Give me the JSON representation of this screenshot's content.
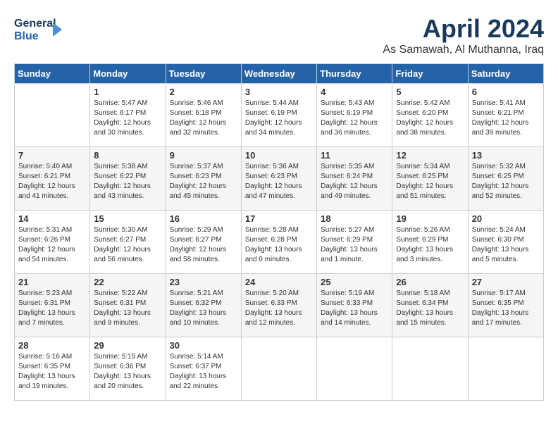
{
  "header": {
    "logo_line1": "General",
    "logo_line2": "Blue",
    "month": "April 2024",
    "location": "As Samawah, Al Muthanna, Iraq"
  },
  "days_of_week": [
    "Sunday",
    "Monday",
    "Tuesday",
    "Wednesday",
    "Thursday",
    "Friday",
    "Saturday"
  ],
  "weeks": [
    [
      {
        "day": "",
        "content": ""
      },
      {
        "day": "1",
        "content": "Sunrise: 5:47 AM\nSunset: 6:17 PM\nDaylight: 12 hours\nand 30 minutes."
      },
      {
        "day": "2",
        "content": "Sunrise: 5:46 AM\nSunset: 6:18 PM\nDaylight: 12 hours\nand 32 minutes."
      },
      {
        "day": "3",
        "content": "Sunrise: 5:44 AM\nSunset: 6:19 PM\nDaylight: 12 hours\nand 34 minutes."
      },
      {
        "day": "4",
        "content": "Sunrise: 5:43 AM\nSunset: 6:19 PM\nDaylight: 12 hours\nand 36 minutes."
      },
      {
        "day": "5",
        "content": "Sunrise: 5:42 AM\nSunset: 6:20 PM\nDaylight: 12 hours\nand 38 minutes."
      },
      {
        "day": "6",
        "content": "Sunrise: 5:41 AM\nSunset: 6:21 PM\nDaylight: 12 hours\nand 39 minutes."
      }
    ],
    [
      {
        "day": "7",
        "content": "Sunrise: 5:40 AM\nSunset: 6:21 PM\nDaylight: 12 hours\nand 41 minutes."
      },
      {
        "day": "8",
        "content": "Sunrise: 5:38 AM\nSunset: 6:22 PM\nDaylight: 12 hours\nand 43 minutes."
      },
      {
        "day": "9",
        "content": "Sunrise: 5:37 AM\nSunset: 6:23 PM\nDaylight: 12 hours\nand 45 minutes."
      },
      {
        "day": "10",
        "content": "Sunrise: 5:36 AM\nSunset: 6:23 PM\nDaylight: 12 hours\nand 47 minutes."
      },
      {
        "day": "11",
        "content": "Sunrise: 5:35 AM\nSunset: 6:24 PM\nDaylight: 12 hours\nand 49 minutes."
      },
      {
        "day": "12",
        "content": "Sunrise: 5:34 AM\nSunset: 6:25 PM\nDaylight: 12 hours\nand 51 minutes."
      },
      {
        "day": "13",
        "content": "Sunrise: 5:32 AM\nSunset: 6:25 PM\nDaylight: 12 hours\nand 52 minutes."
      }
    ],
    [
      {
        "day": "14",
        "content": "Sunrise: 5:31 AM\nSunset: 6:26 PM\nDaylight: 12 hours\nand 54 minutes."
      },
      {
        "day": "15",
        "content": "Sunrise: 5:30 AM\nSunset: 6:27 PM\nDaylight: 12 hours\nand 56 minutes."
      },
      {
        "day": "16",
        "content": "Sunrise: 5:29 AM\nSunset: 6:27 PM\nDaylight: 12 hours\nand 58 minutes."
      },
      {
        "day": "17",
        "content": "Sunrise: 5:28 AM\nSunset: 6:28 PM\nDaylight: 13 hours\nand 0 minutes."
      },
      {
        "day": "18",
        "content": "Sunrise: 5:27 AM\nSunset: 6:29 PM\nDaylight: 13 hours\nand 1 minute."
      },
      {
        "day": "19",
        "content": "Sunrise: 5:26 AM\nSunset: 6:29 PM\nDaylight: 13 hours\nand 3 minutes."
      },
      {
        "day": "20",
        "content": "Sunrise: 5:24 AM\nSunset: 6:30 PM\nDaylight: 13 hours\nand 5 minutes."
      }
    ],
    [
      {
        "day": "21",
        "content": "Sunrise: 5:23 AM\nSunset: 6:31 PM\nDaylight: 13 hours\nand 7 minutes."
      },
      {
        "day": "22",
        "content": "Sunrise: 5:22 AM\nSunset: 6:31 PM\nDaylight: 13 hours\nand 9 minutes."
      },
      {
        "day": "23",
        "content": "Sunrise: 5:21 AM\nSunset: 6:32 PM\nDaylight: 13 hours\nand 10 minutes."
      },
      {
        "day": "24",
        "content": "Sunrise: 5:20 AM\nSunset: 6:33 PM\nDaylight: 13 hours\nand 12 minutes."
      },
      {
        "day": "25",
        "content": "Sunrise: 5:19 AM\nSunset: 6:33 PM\nDaylight: 13 hours\nand 14 minutes."
      },
      {
        "day": "26",
        "content": "Sunrise: 5:18 AM\nSunset: 6:34 PM\nDaylight: 13 hours\nand 15 minutes."
      },
      {
        "day": "27",
        "content": "Sunrise: 5:17 AM\nSunset: 6:35 PM\nDaylight: 13 hours\nand 17 minutes."
      }
    ],
    [
      {
        "day": "28",
        "content": "Sunrise: 5:16 AM\nSunset: 6:35 PM\nDaylight: 13 hours\nand 19 minutes."
      },
      {
        "day": "29",
        "content": "Sunrise: 5:15 AM\nSunset: 6:36 PM\nDaylight: 13 hours\nand 20 minutes."
      },
      {
        "day": "30",
        "content": "Sunrise: 5:14 AM\nSunset: 6:37 PM\nDaylight: 13 hours\nand 22 minutes."
      },
      {
        "day": "",
        "content": ""
      },
      {
        "day": "",
        "content": ""
      },
      {
        "day": "",
        "content": ""
      },
      {
        "day": "",
        "content": ""
      }
    ]
  ]
}
